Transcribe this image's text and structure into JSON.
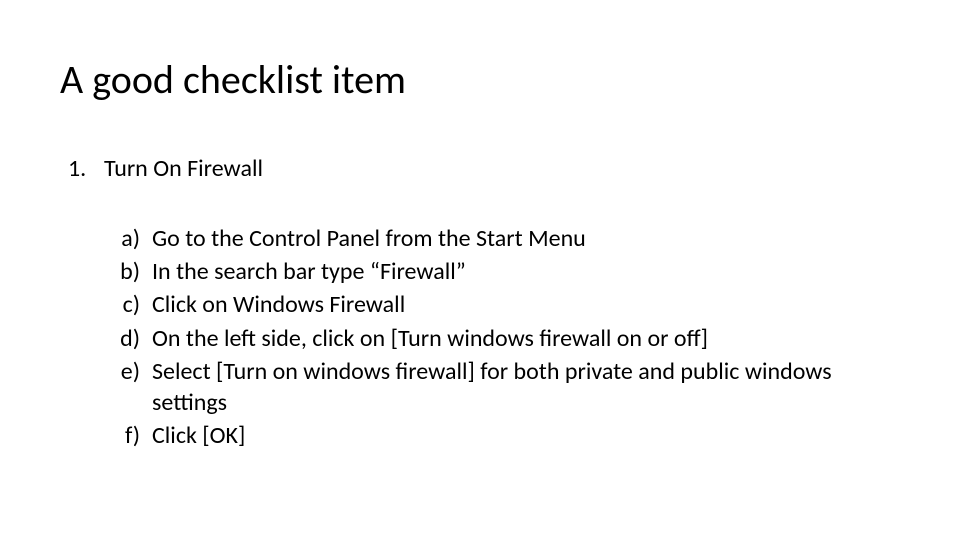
{
  "title": "A good checklist item",
  "list": {
    "marker": "1.",
    "heading": "Turn On Firewall",
    "steps": [
      {
        "marker": "a)",
        "text": "Go to the Control Panel from the Start Menu"
      },
      {
        "marker": "b)",
        "text": "In the search bar type “Firewall”"
      },
      {
        "marker": "c)",
        "text": "Click on Windows Firewall"
      },
      {
        "marker": "d)",
        "text": "On the left side, click on [Turn windows firewall on or off]"
      },
      {
        "marker": "e)",
        "text": "Select [Turn on windows firewall] for both private and public windows settings"
      },
      {
        "marker": "f)",
        "text": "Click [OK]"
      }
    ]
  }
}
